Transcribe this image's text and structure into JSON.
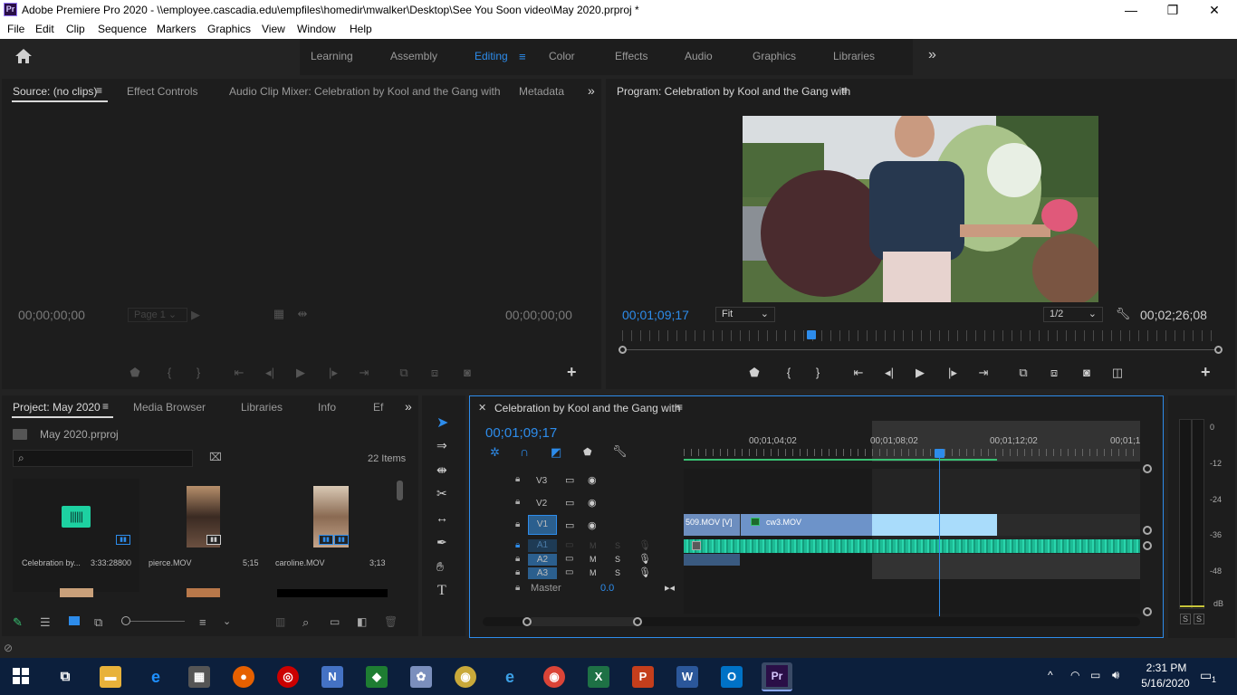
{
  "window": {
    "title": "Adobe Premiere Pro 2020 - \\\\employee.cascadia.edu\\empfiles\\homedir\\mwalker\\Desktop\\See You Soon video\\May 2020.prproj *",
    "app_badge": "Pr",
    "minimize": "—",
    "restore": "❐",
    "close": "✕"
  },
  "menu": [
    "File",
    "Edit",
    "Clip",
    "Sequence",
    "Markers",
    "Graphics",
    "View",
    "Window",
    "Help"
  ],
  "workspaces": {
    "tabs": [
      "Learning",
      "Assembly",
      "Editing",
      "Color",
      "Effects",
      "Audio",
      "Graphics",
      "Libraries"
    ],
    "active": "Editing",
    "more": "»"
  },
  "source_panel": {
    "tabs": [
      "Source: (no clips)",
      "Effect Controls",
      "Audio Clip Mixer: Celebration by Kool and the Gang with",
      "Metadata"
    ],
    "timecode_left": "00;00;00;00",
    "timecode_right": "00;00;00;00",
    "page": "Page 1"
  },
  "program_panel": {
    "title": "Program: Celebration by Kool and the Gang with",
    "timecode": "00;01;09;17",
    "fit": "Fit",
    "resolution": "1/2",
    "duration": "00;02;26;08"
  },
  "project_panel": {
    "tabs": [
      "Project: May 2020",
      "Media Browser",
      "Libraries",
      "Info",
      "Ef"
    ],
    "file": "May 2020.prproj",
    "search_placeholder": "",
    "items_count": "22 Items",
    "items": [
      {
        "name": "Celebration by...",
        "duration": "3:33:28800"
      },
      {
        "name": "pierce.MOV",
        "duration": "5;15"
      },
      {
        "name": "caroline.MOV",
        "duration": "3;13"
      }
    ]
  },
  "timeline": {
    "title": "Celebration by Kool and the Gang with",
    "timecode": "00;01;09;17",
    "ruler": [
      "00;01;04;02",
      "00;01;08;02",
      "00;01;12;02",
      "00;01;1"
    ],
    "video_tracks": [
      "V3",
      "V2",
      "V1"
    ],
    "audio_tracks": [
      "A1",
      "A2",
      "A3"
    ],
    "master_label": "Master",
    "master_value": "0.0",
    "clips": [
      "509.MOV [V]",
      "cw3.MOV"
    ],
    "mute": "M",
    "solo": "S"
  },
  "meter": {
    "scale": [
      "0",
      "-12",
      "-24",
      "-36",
      "-48",
      "dB"
    ],
    "solo_left": "S",
    "solo_right": "S"
  },
  "taskbar": {
    "time": "2:31 PM",
    "date": "5/16/2020",
    "notification_count": "1"
  }
}
